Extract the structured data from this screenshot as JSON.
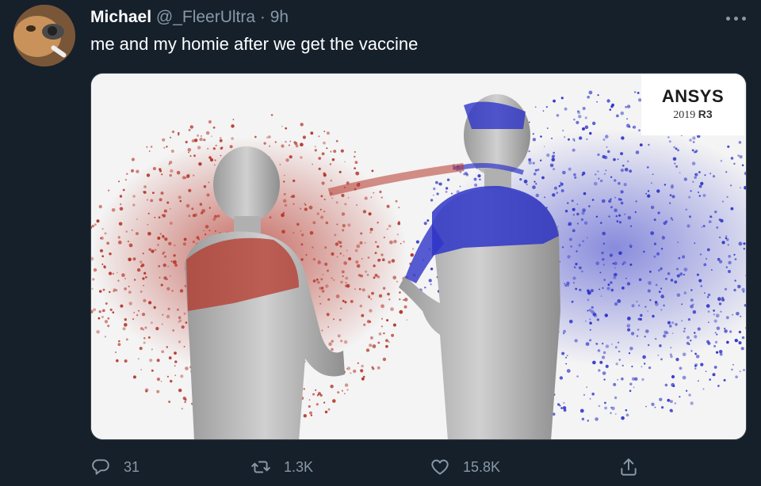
{
  "tweet": {
    "author_name": "Michael",
    "author_handle": "@_FleerUltra",
    "separator": "·",
    "time": "9h",
    "text": "me and my homie after we get the vaccine"
  },
  "media": {
    "watermark_brand": "ANSYS",
    "watermark_year": "2019",
    "watermark_release": "R3",
    "colors": {
      "left_particles": "#b5372b",
      "right_particles": "#2f35c8",
      "figure": "#b8b8b8"
    }
  },
  "actions": {
    "replies": "31",
    "retweets": "1.3K",
    "likes": "15.8K"
  },
  "icons": {
    "reply": "reply-bubble-icon",
    "retweet": "retweet-arrows-icon",
    "like": "heart-icon",
    "share": "share-upload-icon",
    "more": "more-dots-icon"
  }
}
